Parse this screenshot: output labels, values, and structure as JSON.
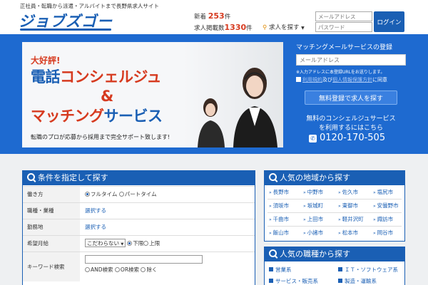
{
  "header": {
    "tagline": "正社員・転職から派遣・アルバイトまで長野県求人サイト",
    "logo": "ジョブズゴー",
    "new_label": "新着",
    "new_count": "253",
    "new_unit": "件",
    "total_label": "求人掲載数",
    "total_count": "1330",
    "total_unit": "件",
    "search_link": "求人を探す",
    "email_placeholder": "メールアドレス",
    "password_placeholder": "パスワード",
    "login_label": "ログイン"
  },
  "banner": {
    "catch": "大好評!",
    "line1_a": "電話",
    "line1_b": "コンシェルジュ",
    "amp": "&",
    "line2_a": "マッチング",
    "line2_b": "サービス",
    "sub": "転職のプロが応募から採用まで完全サポート致します!"
  },
  "matching": {
    "title": "マッチングメールサービスの登録",
    "email_placeholder": "メールアドレス",
    "note": "※入力アドレスに本登録URLをお送りします。",
    "terms_link": "利用規約",
    "and": "及び",
    "privacy_link": "個人情報保護方針",
    "agree": "に同意",
    "submit_label": "無料登録で求人を探す",
    "free_line1": "無料のコンシェルジュサービス",
    "free_line2": "を利用するにはこちら",
    "phone": "0120-170-505"
  },
  "conditions": {
    "title": "条件を指定して探す",
    "rows": {
      "work_style": {
        "label": "働き方",
        "opt1": "フルタイム",
        "opt2": "パートタイム"
      },
      "job_type": {
        "label": "職種・業種",
        "value": "選択する"
      },
      "location": {
        "label": "勤務地",
        "value": "選択する"
      },
      "salary": {
        "label": "希望月給",
        "select": "こだわらない",
        "opt1": "下限",
        "opt2": "上限"
      },
      "keyword": {
        "label": "キーワード検索",
        "opt1": "AND検索",
        "opt2": "OR検索",
        "opt3": "除く"
      }
    }
  },
  "regions": {
    "title": "人気の地域から探す",
    "items": [
      "長野市",
      "中野市",
      "佐久市",
      "塩尻市",
      "須坂市",
      "坂城町",
      "東御市",
      "安曇野市",
      "千曲市",
      "上田市",
      "軽井沢町",
      "諏訪市",
      "飯山市",
      "小諸市",
      "松本市",
      "岡谷市"
    ]
  },
  "jobs": {
    "title": "人気の職種から探す",
    "items": [
      "営業系",
      "ＩＴ・ソフトウェア系",
      "サービス・販売系",
      "製造・運輸系"
    ]
  }
}
